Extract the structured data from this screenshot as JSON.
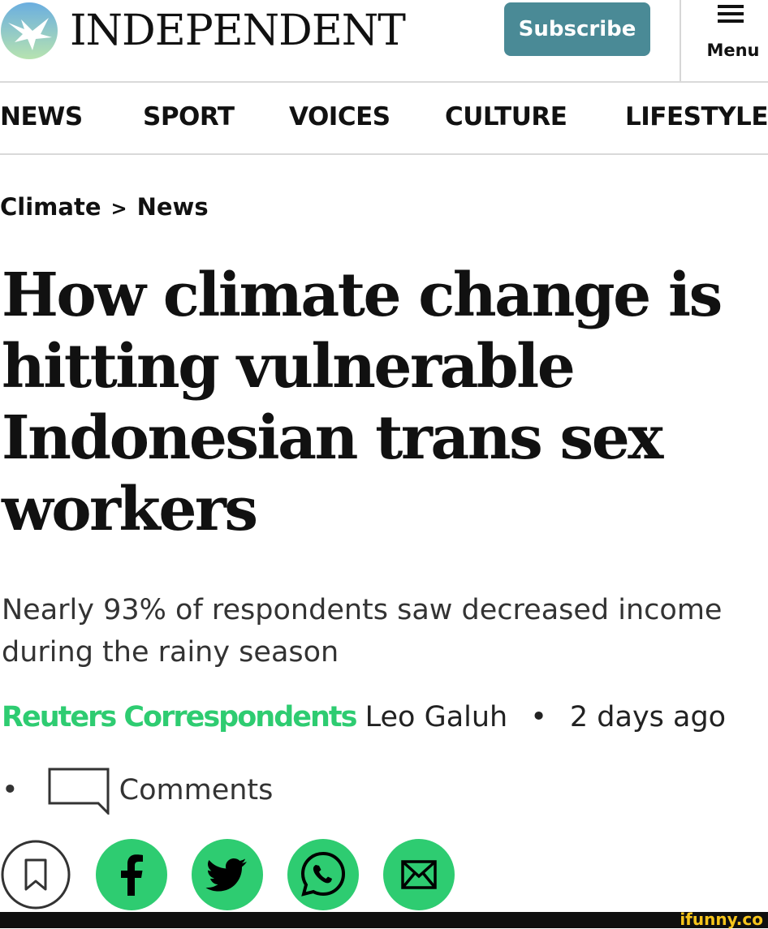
{
  "header": {
    "logo_text": "INDEPENDENT",
    "subscribe_label": "Subscribe",
    "menu_label": "Menu"
  },
  "nav": {
    "items": [
      "NEWS",
      "SPORT",
      "VOICES",
      "CULTURE",
      "LIFESTYLE"
    ]
  },
  "breadcrumb": {
    "section": "Climate",
    "separator": ">",
    "subsection": "News"
  },
  "article": {
    "headline": "How climate change is hitting vulnerable Indonesian trans sex workers",
    "standfirst": "Nearly 93% of respondents saw decreased income during the rainy season",
    "byline_org": "Reuters Correspondents",
    "byline_author": "Leo Galuh",
    "separator": "•",
    "timestamp": "2 days ago",
    "comments_label": "Comments"
  },
  "share": {
    "icons": [
      "bookmark-icon",
      "facebook-icon",
      "twitter-icon",
      "whatsapp-icon",
      "email-icon"
    ]
  },
  "watermark": "ifunny.co",
  "colors": {
    "subscribe_bg": "#4a8a96",
    "share_green": "#2ecc71",
    "byline_org": "#2ecc71",
    "logo_blue": "#6aaee0"
  }
}
